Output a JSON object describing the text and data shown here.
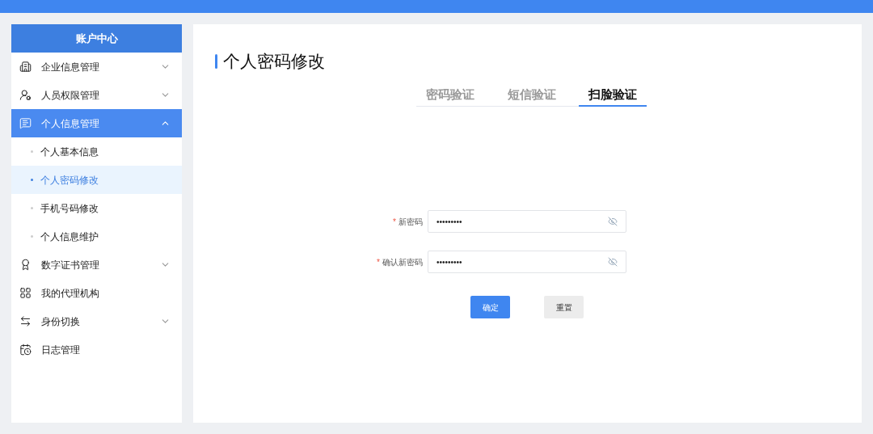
{
  "sidebar": {
    "title": "账户中心",
    "items": [
      {
        "label": "企业信息管理",
        "expandable": true,
        "expanded": false,
        "selected": false
      },
      {
        "label": "人员权限管理",
        "expandable": true,
        "expanded": false,
        "selected": false
      },
      {
        "label": "个人信息管理",
        "expandable": true,
        "expanded": true,
        "selected": true,
        "children": [
          {
            "label": "个人基本信息",
            "selected": false
          },
          {
            "label": "个人密码修改",
            "selected": true
          },
          {
            "label": "手机号码修改",
            "selected": false
          },
          {
            "label": "个人信息维护",
            "selected": false
          }
        ]
      },
      {
        "label": "数字证书管理",
        "expandable": true,
        "expanded": false,
        "selected": false
      },
      {
        "label": "我的代理机构",
        "expandable": false,
        "selected": false
      },
      {
        "label": "身份切换",
        "expandable": true,
        "expanded": false,
        "selected": false
      },
      {
        "label": "日志管理",
        "expandable": false,
        "selected": false
      }
    ]
  },
  "page": {
    "title": "个人密码修改",
    "tabs": [
      {
        "label": "密码验证",
        "selected": false
      },
      {
        "label": "短信验证",
        "selected": false
      },
      {
        "label": "扫脸验证",
        "selected": true
      }
    ],
    "fields": [
      {
        "marker": "*",
        "label": "新密码",
        "value": "•••••••••"
      },
      {
        "marker": "*",
        "label": "确认新密码",
        "value": "•••••••••"
      }
    ],
    "buttons": [
      {
        "label": "确定",
        "kind": "primary"
      },
      {
        "label": "重置",
        "kind": "secondary"
      }
    ]
  }
}
